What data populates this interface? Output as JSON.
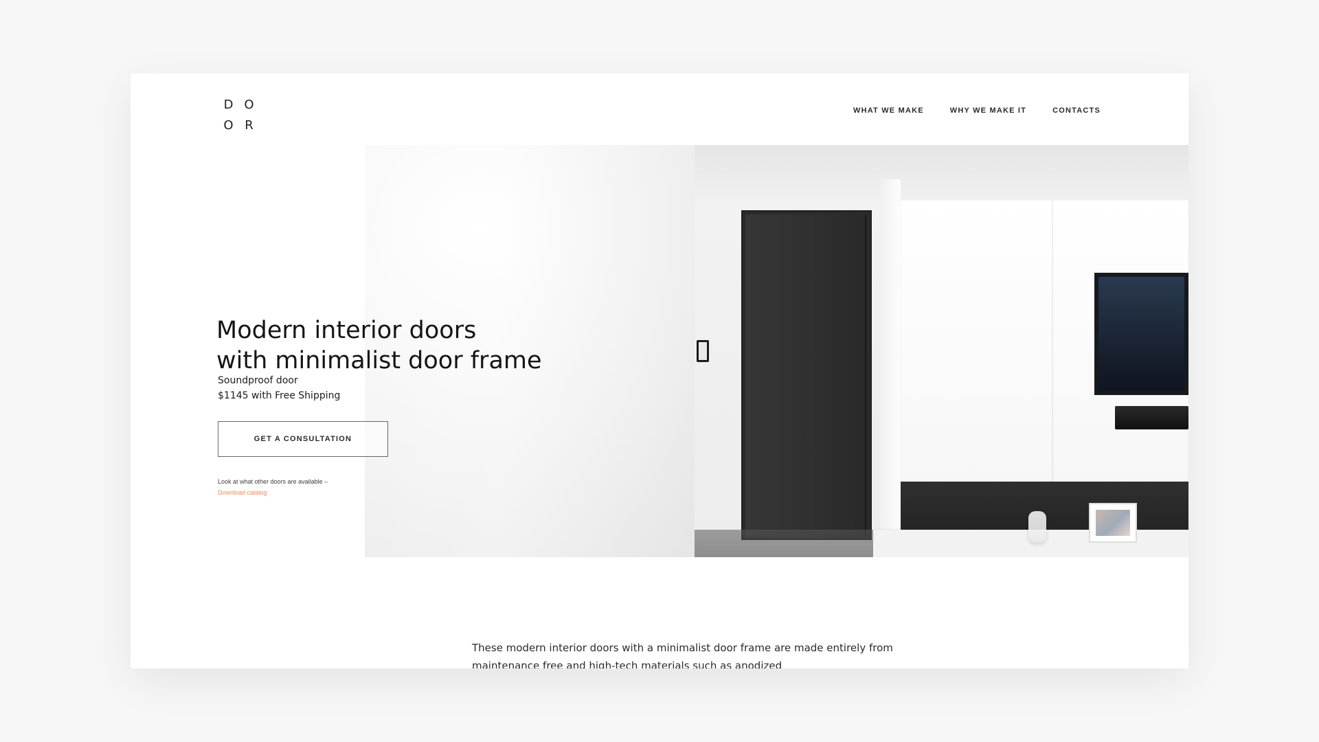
{
  "brand": {
    "logo_letters": [
      "D",
      "O",
      "O",
      "R"
    ]
  },
  "nav": {
    "items": [
      {
        "label": "WHAT WE MAKE"
      },
      {
        "label": "WHY WE MAKE IT"
      },
      {
        "label": "CONTACTS"
      }
    ]
  },
  "hero": {
    "title_line_1": "Modern interior doors",
    "title_line_2": "with minimalist door frame",
    "product_line_1": "Soundproof door",
    "product_line_2": "$1145 with Free Shipping",
    "cta_label": "GET A CONSULTATION",
    "catalog_prompt": "Look at what other doors are available –",
    "catalog_link_label": "Download catalog"
  },
  "intro": {
    "paragraph": "These modern interior doors with a minimalist door frame are made entirely from maintenance free and high-tech materials such as anodized"
  },
  "colors": {
    "accent_link": "#f08a55",
    "text_primary": "#151515",
    "background": "#ffffff"
  }
}
